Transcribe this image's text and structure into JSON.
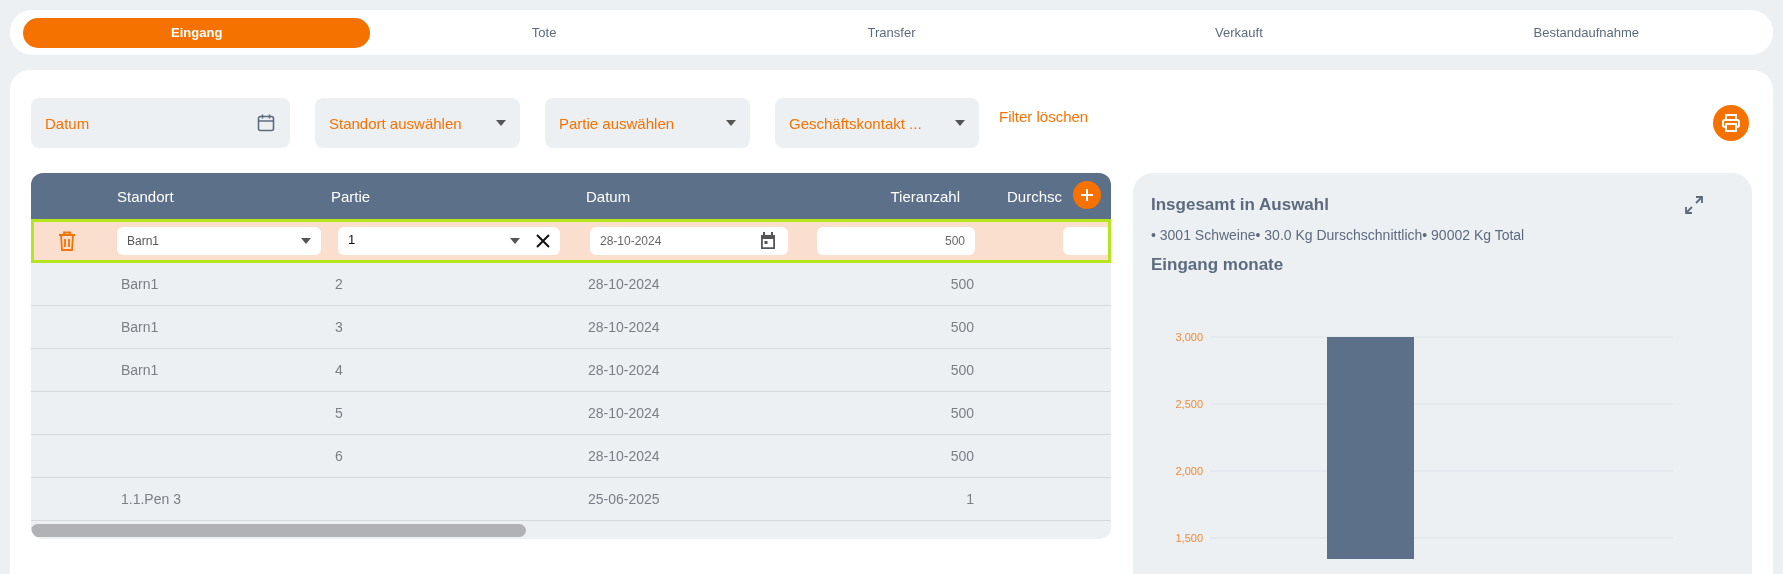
{
  "tabs": [
    {
      "label": "Eingang",
      "selected": true
    },
    {
      "label": "Tote",
      "selected": false
    },
    {
      "label": "Transfer",
      "selected": false
    },
    {
      "label": "Verkauft",
      "selected": false
    },
    {
      "label": "Bestandaufnahme",
      "selected": false
    }
  ],
  "filters": [
    {
      "kind": "date",
      "placeholder": "Datum"
    },
    {
      "kind": "select",
      "placeholder": "Standort auswählen"
    },
    {
      "kind": "select",
      "placeholder": "Partie auswählen"
    },
    {
      "kind": "select",
      "placeholder": "Geschäftskontakt ..."
    }
  ],
  "clear_filters": "Filter löschen",
  "table": {
    "columns": [
      "Standort",
      "Partie",
      "Datum",
      "Tieranzahl",
      "Durchsc"
    ],
    "edit_row": {
      "standort": "Barn1",
      "partie": "1",
      "datum": "28-10-2024",
      "tieranzahl": "500"
    },
    "rows": [
      {
        "standort": "Barn1",
        "partie": "2",
        "datum": "28-10-2024",
        "tieranzahl": "500"
      },
      {
        "standort": "Barn1",
        "partie": "3",
        "datum": "28-10-2024",
        "tieranzahl": "500"
      },
      {
        "standort": "Barn1",
        "partie": "4",
        "datum": "28-10-2024",
        "tieranzahl": "500"
      },
      {
        "partie": "5",
        "datum": "28-10-2024",
        "tieranzahl": "500"
      },
      {
        "partie": "6",
        "datum": "28-10-2024",
        "tieranzahl": "500"
      },
      {
        "standort": "1.1.Pen 3",
        "datum": "25-06-2025",
        "tieranzahl": "1"
      }
    ]
  },
  "summary": {
    "title": "Insgesamt in Auswahl",
    "text": "• 3001 Schweine• 30.0 Kg Durschschnittlich• 90002 Kg Total",
    "chart_title": "Eingang monate",
    "chart_data": {
      "type": "bar",
      "values": [
        3000
      ],
      "ylim": [
        1343,
        3000
      ],
      "grid": true,
      "yticks": [
        {
          "value": 1500,
          "label": "1,500"
        },
        {
          "value": 2000,
          "label": "2,000"
        },
        {
          "value": 2500,
          "label": "2,500"
        },
        {
          "value": 3000,
          "label": "3,000"
        }
      ]
    }
  }
}
